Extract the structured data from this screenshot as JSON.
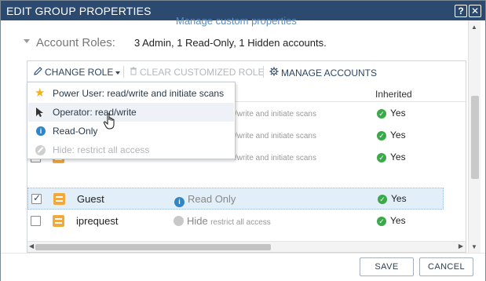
{
  "window": {
    "title": "EDIT GROUP PROPERTIES",
    "help_label": "?",
    "close_label": "✕"
  },
  "header": {
    "manage_custom_properties": "Manage custom properties",
    "account_roles_label": "Account Roles:",
    "account_roles_summary": "3 Admin, 1 Read-Only, 1 Hidden accounts."
  },
  "toolbar": {
    "change_role": "CHANGE ROLE",
    "clear_customized_role": "CLEAR CUSTOMIZED ROLE",
    "manage_accounts": "MANAGE ACCOUNTS"
  },
  "table": {
    "columns": {
      "inherited": "Inherited"
    },
    "rows": [
      {
        "name": "",
        "permission_trunc": "/write and initiate scans",
        "inherited": "Yes",
        "checked": false
      },
      {
        "name": "",
        "permission_trunc": "/write and initiate scans",
        "inherited": "Yes",
        "checked": false
      },
      {
        "name": "",
        "permission_trunc": "/write and initiate scans",
        "inherited": "Yes",
        "checked": false
      },
      {
        "name": "Guest",
        "permission_main": "Read Only",
        "permission_sub": "",
        "inherited": "Yes",
        "checked": true
      },
      {
        "name": "iprequest",
        "permission_main": "Hide",
        "permission_sub": "restrict all access",
        "inherited": "Yes",
        "checked": false
      }
    ]
  },
  "role_menu": {
    "items": [
      {
        "label": "Power User: read/write and initiate scans",
        "icon": "star-icon",
        "disabled": false
      },
      {
        "label": "Operator: read/write",
        "icon": "cursor-arrow-icon",
        "disabled": false
      },
      {
        "label": "Read-Only",
        "icon": "info-icon",
        "disabled": false
      },
      {
        "label": "Hide: restrict all access",
        "icon": "hide-icon",
        "disabled": true
      }
    ]
  },
  "footer": {
    "save": "SAVE",
    "cancel": "CANCEL"
  },
  "colors": {
    "titlebar": "#2c4a70",
    "accent_link": "#2b4766",
    "selected_row": "#e2eef8",
    "ok_green": "#39a94a",
    "info_blue": "#2e86c8",
    "group_orange": "#f3a83b"
  }
}
